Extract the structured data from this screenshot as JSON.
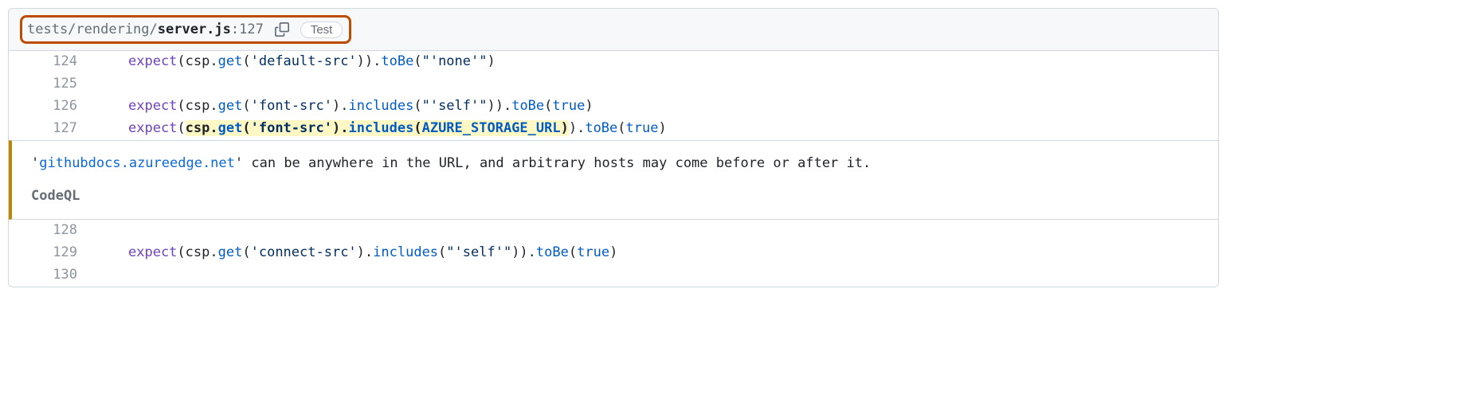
{
  "header": {
    "path_prefix": "tests/rendering/",
    "filename": "server.js",
    "line_suffix": ":127",
    "test_badge": "Test"
  },
  "lines": [
    {
      "num": "124"
    },
    {
      "num": "125"
    },
    {
      "num": "126"
    },
    {
      "num": "127"
    },
    {
      "num": "128"
    },
    {
      "num": "129"
    },
    {
      "num": "130"
    }
  ],
  "code": {
    "l124": {
      "fn": "expect",
      "obj": "csp",
      "m1": "get",
      "arg1": "'default-src'",
      "m2": "toBe",
      "arg2": "\"'none'\""
    },
    "l126": {
      "fn": "expect",
      "obj": "csp",
      "m1": "get",
      "arg1": "'font-src'",
      "m2": "includes",
      "arg2": "\"'self'\"",
      "m3": "toBe",
      "arg3": "true"
    },
    "l127": {
      "fn": "expect",
      "obj": "csp",
      "m1": "get",
      "arg1": "'font-src'",
      "m2": "includes",
      "arg2": "AZURE_STORAGE_URL",
      "m3": "toBe",
      "arg3": "true"
    },
    "l129": {
      "fn": "expect",
      "obj": "csp",
      "m1": "get",
      "arg1": "'connect-src'",
      "m2": "includes",
      "arg2": "\"'self'\"",
      "m3": "toBe",
      "arg3": "true"
    }
  },
  "alert": {
    "quote_open": "'",
    "link": "githubdocs.azureedge.net",
    "quote_close": "'",
    "rest": " can be anywhere in the URL, and arbitrary hosts may come before or after it.",
    "source": "CodeQL"
  }
}
